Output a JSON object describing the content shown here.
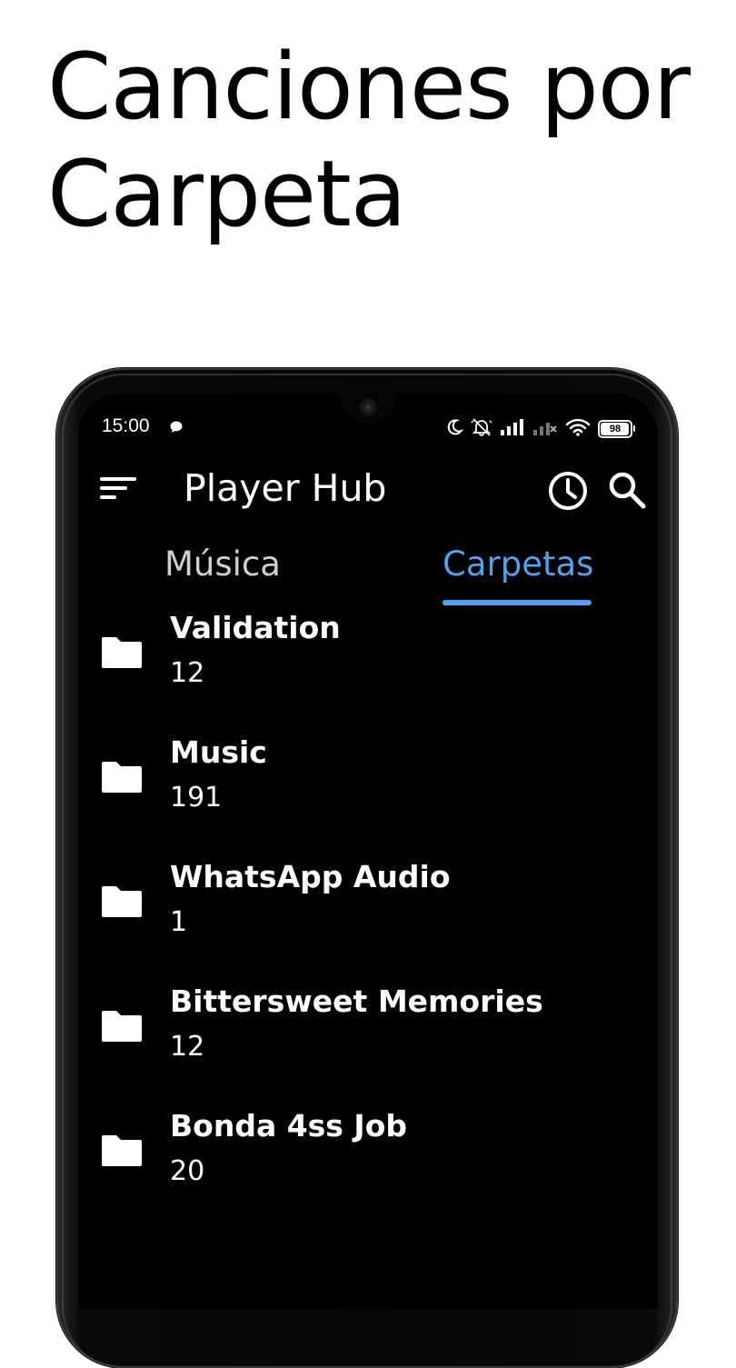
{
  "headline": {
    "line1": "Canciones por",
    "line2": "Carpeta"
  },
  "status_bar": {
    "time": "15:00",
    "battery": "98",
    "icons": [
      "chat-bubble-icon",
      "moon-icon",
      "bell-off-icon",
      "signal-icon",
      "signal-no-service-icon",
      "wifi-icon",
      "battery-icon"
    ]
  },
  "app_bar": {
    "title": "Player Hub",
    "icons": [
      "menu-icon",
      "history-icon",
      "search-icon"
    ]
  },
  "tabs": [
    {
      "label": "Música",
      "selected": false
    },
    {
      "label": "Carpetas",
      "selected": true
    }
  ],
  "folders": [
    {
      "name": "Validation",
      "count": "12"
    },
    {
      "name": "Music",
      "count": "191"
    },
    {
      "name": "WhatsApp Audio",
      "count": "1"
    },
    {
      "name": "Bittersweet Memories",
      "count": "12"
    },
    {
      "name": "Bonda 4ss Job",
      "count": "20"
    }
  ],
  "colors": {
    "accent": "#4da3ef",
    "screen_background": "#000000",
    "page_background": "#ffffff"
  }
}
